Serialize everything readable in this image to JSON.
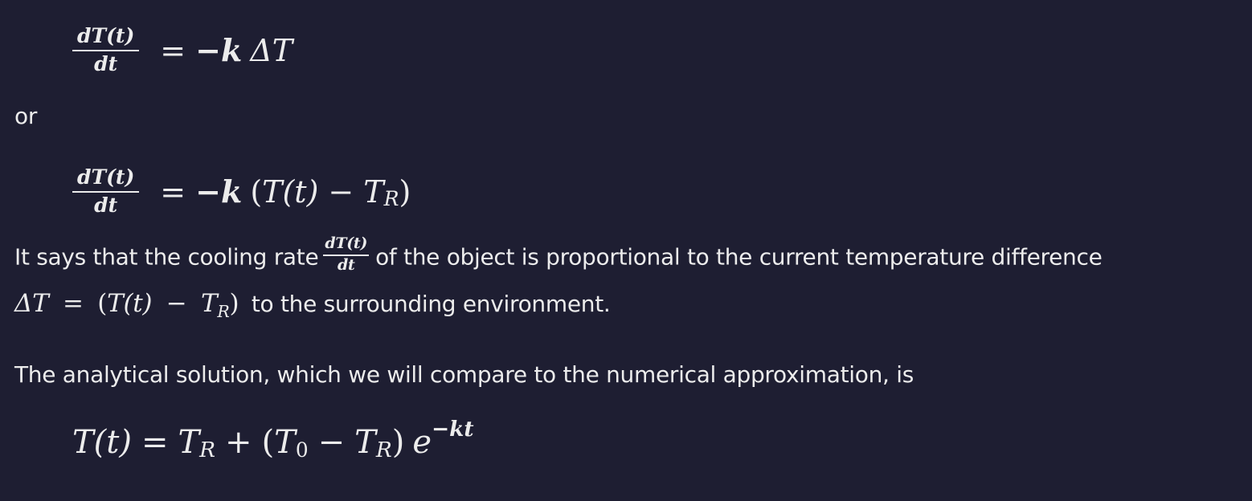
{
  "equations": {
    "eq1": {
      "num": "dT(t)",
      "den": "dt",
      "equals": "=",
      "rhs_minus_k": "−k",
      "rhs_delta_t": "ΔT"
    },
    "eq2": {
      "num": "dT(t)",
      "den": "dt",
      "equals": "=",
      "rhs_minus_k": "−k",
      "open_paren": "(",
      "t_of_t": "T(t)",
      "minus": "−",
      "t_r_base": "T",
      "t_r_sub": "R",
      "close_paren": ")"
    },
    "eq3": {
      "lhs": "T(t)",
      "equals": "=",
      "t_r_base": "T",
      "t_r_sub": "R",
      "plus": "+",
      "open_paren": "(",
      "t_0_base": "T",
      "t_0_sub": "0",
      "minus": "−",
      "t_r2_base": "T",
      "t_r2_sub": "R",
      "close_paren": ")",
      "exp_base": "e",
      "exp_power": "−kt"
    }
  },
  "text": {
    "or": "or",
    "para1_before": "It says that the cooling rate",
    "para1_frac_num": "dT(t)",
    "para1_frac_den": "dt",
    "para1_after": "of the object is proportional to the current temperature difference",
    "para1_line2_math_delta": "ΔT",
    "para1_line2_math_equals": "=",
    "para1_line2_math_open": "(",
    "para1_line2_math_t": "T(t)",
    "para1_line2_math_minus": "−",
    "para1_line2_math_tr_base": "T",
    "para1_line2_math_tr_sub": "R",
    "para1_line2_math_close": ")",
    "para1_line2_rest": "to the surrounding environment.",
    "para2": "The analytical solution, which we will compare to the numerical approximation, is"
  }
}
